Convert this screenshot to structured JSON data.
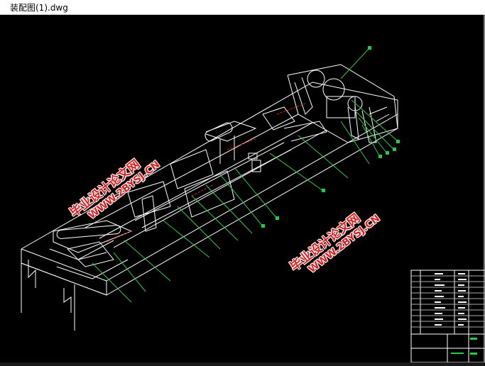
{
  "window": {
    "title": "装配图(1).dwg"
  },
  "watermarks": [
    {
      "cn": "毕业设计论文网",
      "url": "WWW.2BYSJ.CN"
    },
    {
      "cn": "毕业设计论文网",
      "url": "WWW.2BYSJ.CN"
    }
  ],
  "colors": {
    "drawing": "#ffffff",
    "leader": "#22cc44",
    "accent": "#e02020",
    "background": "#000000"
  }
}
